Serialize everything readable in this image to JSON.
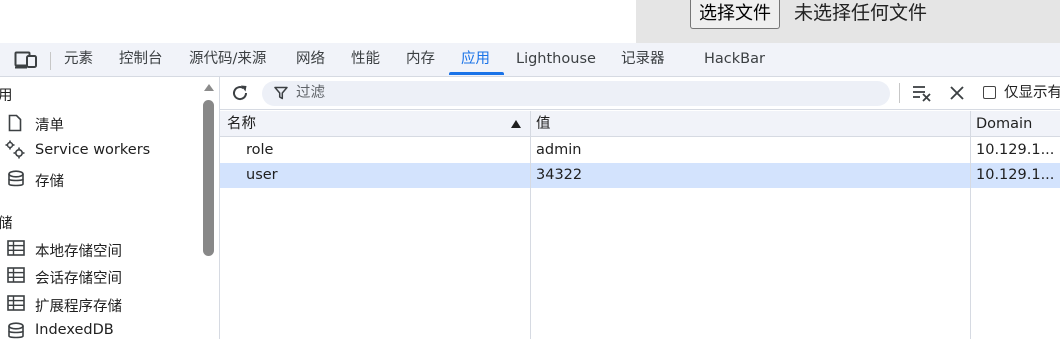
{
  "page": {
    "file_button_label": "选择文件",
    "file_status": "未选择任何文件"
  },
  "tabs": [
    "元素",
    "控制台",
    "源代码/来源",
    "网络",
    "性能",
    "内存",
    "应用",
    "Lighthouse",
    "记录器",
    "HackBar"
  ],
  "active_tab": "应用",
  "sidebar": {
    "section_app_partial": "用",
    "app_items": [
      {
        "label": "清单",
        "icon": "document-icon"
      },
      {
        "label": "Service workers",
        "icon": "gears-icon"
      },
      {
        "label": "存储",
        "icon": "database-icon"
      }
    ],
    "section_storage_partial": "储",
    "storage_items": [
      {
        "label": "本地存储空间",
        "icon": "table-icon"
      },
      {
        "label": "会话存储空间",
        "icon": "table-icon"
      },
      {
        "label": "扩展程序存储",
        "icon": "table-icon"
      },
      {
        "label": "IndexedDB",
        "icon": "database-icon"
      }
    ]
  },
  "toolbar": {
    "filter_placeholder": "过滤",
    "show_only_label": "仅显示有"
  },
  "table": {
    "columns": [
      "名称",
      "值",
      "Domain"
    ],
    "sort_column": "名称",
    "sort_direction": "ascending",
    "rows": [
      {
        "name": "role",
        "value": "admin",
        "domain": "10.129.1...",
        "selected": false
      },
      {
        "name": "user",
        "value": "34322",
        "domain": "10.129.1...",
        "selected": true
      }
    ]
  },
  "colors": {
    "accent": "#1a73e8",
    "selected_row": "#d3e3fd",
    "header_bg": "#f1f3f9"
  }
}
